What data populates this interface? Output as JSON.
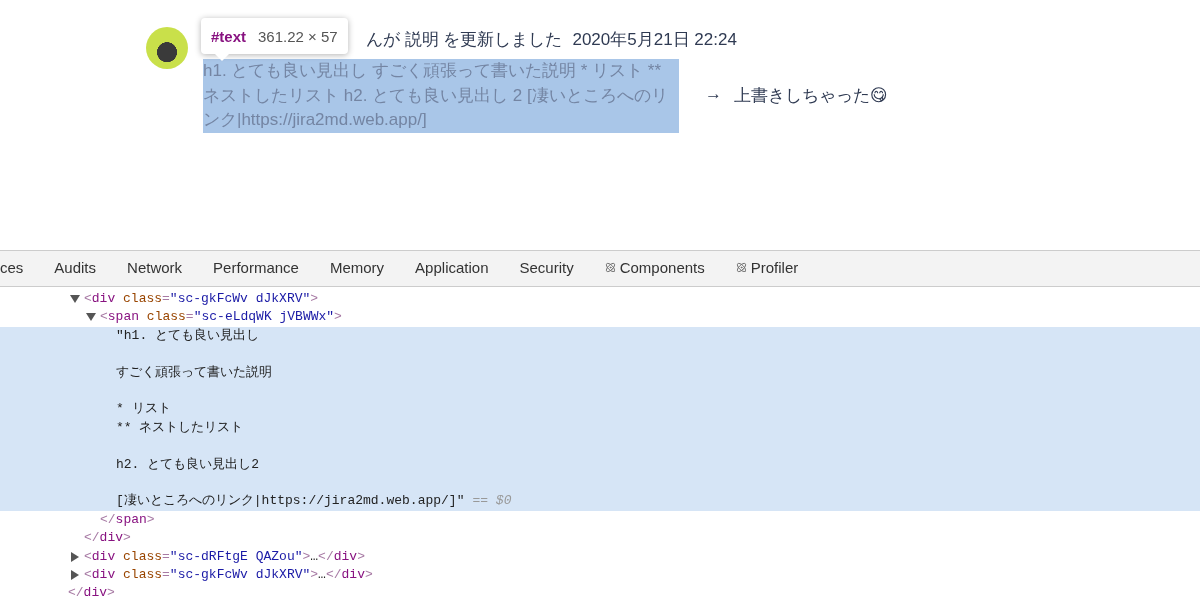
{
  "activity": {
    "header_text": "んが 説明 を更新しました",
    "time": "2020年5月21日 22:24",
    "description": "h1. とても良い見出し すごく頑張って書いた説明 * リスト ** ネストしたリスト h2. とても良い見出し 2  [凄いところへのリンク|https://jira2md.web.app/]",
    "description_selected": true,
    "arrow": "→",
    "change_note": "上書きしちゃった😋"
  },
  "inspect_tooltip": {
    "node": "#text",
    "size": "361.22 × 57"
  },
  "devtools_tabs": [
    {
      "label": "ces",
      "kind": "panel",
      "selected": false
    },
    {
      "label": "Audits",
      "kind": "panel",
      "selected": false
    },
    {
      "label": "Network",
      "kind": "panel",
      "selected": false
    },
    {
      "label": "Performance",
      "kind": "panel",
      "selected": false
    },
    {
      "label": "Memory",
      "kind": "panel",
      "selected": false
    },
    {
      "label": "Application",
      "kind": "panel",
      "selected": false
    },
    {
      "label": "Security",
      "kind": "panel",
      "selected": false
    },
    {
      "label": "Components",
      "kind": "extension",
      "selected": false
    },
    {
      "label": "Profiler",
      "kind": "extension",
      "selected": false
    }
  ],
  "elements_tree": [
    {
      "kind": "element",
      "line": "<div class=\"sc-gkFcWv dJkXRV\">",
      "expanded": true,
      "selected": false,
      "closing": "</div>",
      "children": [
        {
          "kind": "element",
          "line": "<span class=\"sc-eLdqWK jVBWWx\">",
          "expanded": true,
          "selected": false,
          "closing": "</span>",
          "children": [
            {
              "kind": "text",
              "paragraphs": [
                [
                  "\"h1. とても良い見出し"
                ],
                [
                  "すごく頑張って書いた説明"
                ],
                [
                  "* リスト",
                  "** ネストしたリスト"
                ],
                [
                  "h2. とても良い見出し2"
                ],
                [
                  "[凄いところへのリンク|https://jira2md.web.app/]\""
                ]
              ],
              "console_ref": "== $0",
              "selected": true
            }
          ]
        }
      ]
    },
    {
      "kind": "element",
      "line": "<div class=\"sc-dRFtgE QAZou\">…</div>",
      "expanded": false,
      "selected": false
    },
    {
      "kind": "element",
      "line": "<div class=\"sc-gkFcWv dJkXRV\">…</div>",
      "expanded": false,
      "selected": false
    },
    {
      "kind": "closing",
      "line": "</div>"
    }
  ]
}
